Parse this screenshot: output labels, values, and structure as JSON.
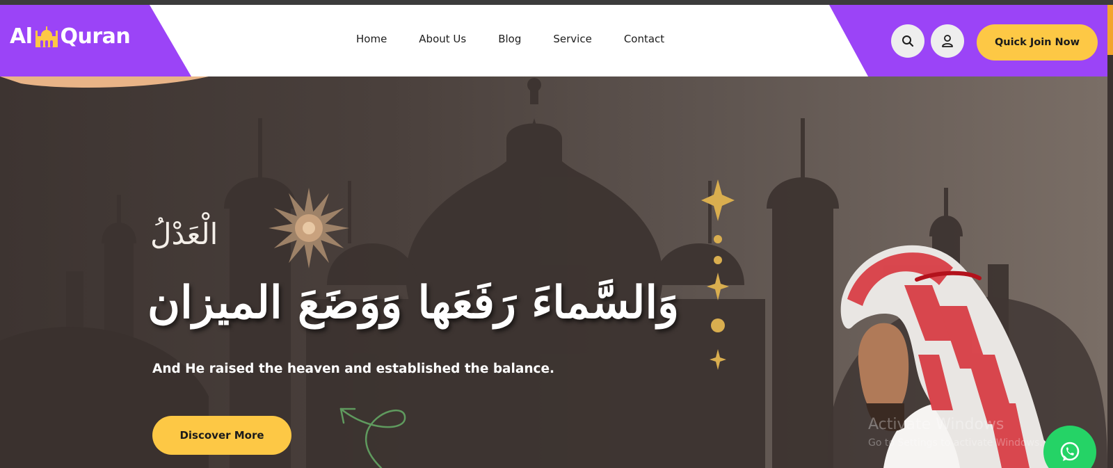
{
  "brand": {
    "logo_left": "Al",
    "logo_right": "Quran",
    "primary_color": "#9b44f7",
    "accent_color": "#fdc845"
  },
  "nav": {
    "items": [
      "Home",
      "About Us",
      "Blog",
      "Service",
      "Contact"
    ]
  },
  "header": {
    "search_icon": "search-icon",
    "user_icon": "user-icon",
    "cta_label": "Quick Join Now"
  },
  "hero": {
    "arabic_small": "الْعَدْلُ",
    "arabic_main": "وَالسَّماءَ رَفَعَها وَوَضَعَ الميزان",
    "tagline": "And He raised the heaven and established the balance.",
    "cta_label": "Discover More"
  },
  "overlay": {
    "watermark_title": "Activate Windows",
    "watermark_sub": "Go to Settings to activate Windows.",
    "whatsapp_icon": "whatsapp-icon",
    "whatsapp_color": "#25d366"
  }
}
